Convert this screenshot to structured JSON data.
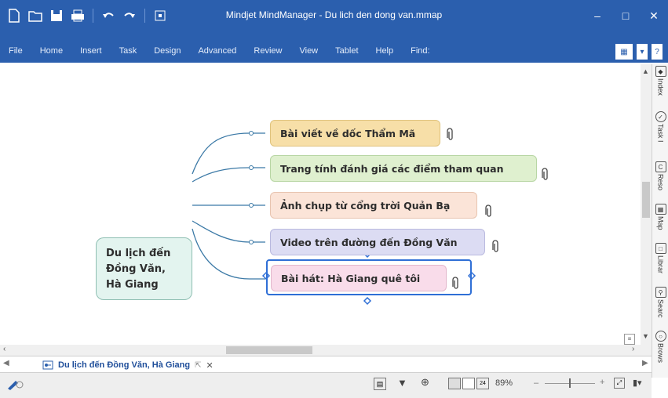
{
  "window": {
    "title": "Mindjet MindManager - Du lich den dong van.mmap",
    "min_glyph": "–",
    "max_glyph": "□",
    "close_glyph": "✕"
  },
  "qat_icons": [
    "new-document-icon",
    "open-icon",
    "save-icon",
    "print-icon",
    "undo-icon",
    "redo-icon",
    "customize-icon"
  ],
  "menu": {
    "items": [
      "File",
      "Home",
      "Insert",
      "Task",
      "Design",
      "Advanced",
      "Review",
      "View",
      "Tablet",
      "Help",
      "Find:"
    ]
  },
  "map": {
    "central": "Du lịch đến\nĐồng Văn,\nHà Giang",
    "topics": [
      {
        "label": "Bài viết về dốc Thẩm Mã",
        "color": "#f7dfa8",
        "border": "#e0c37d"
      },
      {
        "label": "Trang tính đánh giá các điểm tham quan",
        "color": "#dff0cf",
        "border": "#b8d6a4"
      },
      {
        "label": "Ảnh chụp từ cổng trời Quản Bạ",
        "color": "#fbe4d8",
        "border": "#e8c4b0"
      },
      {
        "label": "Video trên đường đến Đồng Văn",
        "color": "#dcdcf3",
        "border": "#b9b9df"
      },
      {
        "label": "Bài hát: Hà Giang quê tôi",
        "color": "#f9dcea",
        "border": "#2f6fd6"
      }
    ],
    "connector_color": "#3b79a6",
    "selection_color": "#2f6fd6"
  },
  "side_panel": {
    "items": [
      "Index",
      "Task I",
      "Reso",
      "Map",
      "Librar",
      "Searc",
      "Brows"
    ]
  },
  "doc_tab": {
    "label": "Du lịch đến Đồng Văn, Hà Giang",
    "close": "✕"
  },
  "status": {
    "zoom": "89%",
    "page_count": "24"
  }
}
